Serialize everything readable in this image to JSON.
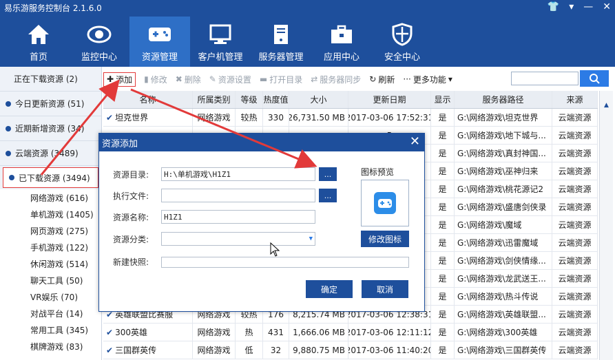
{
  "window": {
    "title": "易乐游服务控制台 2.1.6.0"
  },
  "nav": [
    {
      "label": "首页",
      "icon": "home-icon"
    },
    {
      "label": "监控中心",
      "icon": "eye-icon"
    },
    {
      "label": "资源管理",
      "icon": "gamepad-icon"
    },
    {
      "label": "客户机管理",
      "icon": "monitor-icon"
    },
    {
      "label": "服务器管理",
      "icon": "server-icon"
    },
    {
      "label": "应用中心",
      "icon": "toolbox-icon"
    },
    {
      "label": "安全中心",
      "icon": "shield-icon"
    }
  ],
  "sidebar": {
    "categories": [
      {
        "label": "正在下载资源 (2)"
      },
      {
        "label": "今日更新资源 (51)"
      },
      {
        "label": "近期新增资源 (34)"
      },
      {
        "label": "云端资源 (3489)"
      },
      {
        "label": "已下载资源 (3494)"
      }
    ],
    "subs": [
      {
        "label": "网络游戏 (616)"
      },
      {
        "label": "单机游戏 (1405)"
      },
      {
        "label": "网页游戏 (275)"
      },
      {
        "label": "手机游戏 (122)"
      },
      {
        "label": "休闲游戏 (514)"
      },
      {
        "label": "聊天工具 (50)"
      },
      {
        "label": "VR娱乐 (70)"
      },
      {
        "label": "对战平台 (14)"
      },
      {
        "label": "常用工具 (345)"
      },
      {
        "label": "棋牌游戏 (83)"
      }
    ]
  },
  "toolbar": {
    "add": "添加",
    "edit": "修改",
    "delete": "删除",
    "settings": "资源设置",
    "open_dir": "打开目录",
    "sync": "服务器同步",
    "refresh": "刷新",
    "more": "更多功能"
  },
  "table": {
    "headers": [
      "名称",
      "所属类别",
      "等级",
      "热度值",
      "大小",
      "更新日期",
      "显示",
      "服务器路径",
      "来源"
    ],
    "rows": [
      {
        "name": "坦克世界",
        "cat": "网络游戏",
        "level": "较热",
        "heat": "330",
        "size": "26,731.50 MB",
        "date": "2017-03-06 17:52:31",
        "show": "是",
        "path": "G:\\网络游戏\\坦克世界",
        "src": "云端资源"
      },
      {
        "name": "",
        "cat": "",
        "level": "",
        "heat": "",
        "size": "",
        "date": "5",
        "show": "是",
        "path": "G:\\网络游戏\\地下城与...",
        "src": "云端资源"
      },
      {
        "name": "",
        "cat": "",
        "level": "",
        "heat": "",
        "size": "",
        "date": "4",
        "show": "是",
        "path": "G:\\网络游戏\\真封神国...",
        "src": "云端资源"
      },
      {
        "name": "",
        "cat": "",
        "level": "",
        "heat": "",
        "size": "",
        "date": "5",
        "show": "是",
        "path": "G:\\网络游戏\\巫神归来",
        "src": "云端资源"
      },
      {
        "name": "",
        "cat": "",
        "level": "",
        "heat": "",
        "size": "",
        "date": "1",
        "show": "是",
        "path": "G:\\网络游戏\\桃花源记2",
        "src": "云端资源"
      },
      {
        "name": "",
        "cat": "",
        "level": "",
        "heat": "",
        "size": "",
        "date": "1",
        "show": "是",
        "path": "G:\\网络游戏\\盛唐剑侠录",
        "src": "云端资源"
      },
      {
        "name": "",
        "cat": "",
        "level": "",
        "heat": "",
        "size": "",
        "date": "0",
        "show": "是",
        "path": "G:\\网络游戏\\魔域",
        "src": "云端资源"
      },
      {
        "name": "",
        "cat": "",
        "level": "",
        "heat": "",
        "size": "",
        "date": "0",
        "show": "是",
        "path": "G:\\网络游戏\\迅雷魔域",
        "src": "云端资源"
      },
      {
        "name": "",
        "cat": "",
        "level": "",
        "heat": "",
        "size": "",
        "date": "2",
        "show": "是",
        "path": "G:\\网络游戏\\剑侠情缘...",
        "src": "云端资源"
      },
      {
        "name": "",
        "cat": "",
        "level": "",
        "heat": "",
        "size": "",
        "date": "9",
        "show": "是",
        "path": "G:\\网络游戏\\龙武送王...",
        "src": "云端资源"
      },
      {
        "name": "",
        "cat": "",
        "level": "",
        "heat": "",
        "size": "",
        "date": "0",
        "show": "是",
        "path": "G:\\网络游戏\\热斗传说",
        "src": "云端资源"
      },
      {
        "name": "英雄联盟比赛服",
        "cat": "网络游戏",
        "level": "较热",
        "heat": "176",
        "size": "8,215.74 MB",
        "date": "2017-03-06 12:38:31",
        "show": "是",
        "path": "G:\\网络游戏\\英雄联盟...",
        "src": "云端资源"
      },
      {
        "name": "300英雄",
        "cat": "网络游戏",
        "level": "热",
        "heat": "431",
        "size": "1,666.06 MB",
        "date": "2017-03-06 12:11:12",
        "show": "是",
        "path": "G:\\网络游戏\\300英雄",
        "src": "云端资源"
      },
      {
        "name": "三国群英传",
        "cat": "网络游戏",
        "level": "低",
        "heat": "32",
        "size": "9,880.75 MB",
        "date": "2017-03-06 11:40:20",
        "show": "是",
        "path": "G:\\网络游戏\\三国群英传",
        "src": "云端资源"
      }
    ]
  },
  "dialog": {
    "title": "资源添加",
    "dir_label": "资源目录:",
    "dir_value": "H:\\单机游戏\\H1Z1",
    "exe_label": "执行文件:",
    "exe_value": "",
    "name_label": "资源名称:",
    "name_value": "H1Z1",
    "cat_label": "资源分类:",
    "cat_value": "",
    "shortcut_label": "新建快照:",
    "browse": "...",
    "preview_label": "图标预览",
    "change_icon": "修改图标",
    "ok": "确定",
    "cancel": "取消"
  }
}
